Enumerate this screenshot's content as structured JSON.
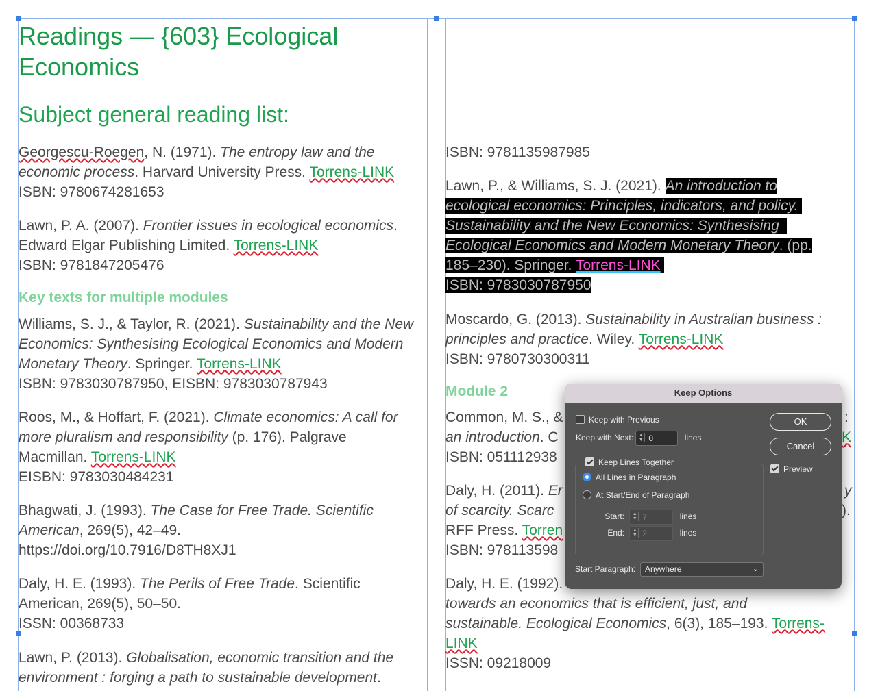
{
  "left": {
    "title": "Readings — {603} Ecological Economics",
    "subtitle": "Subject general reading list:",
    "entries": [
      {
        "pre": "Georgescu-Roegen",
        "pre2": ", N. (1971). ",
        "italic": "The entropy law and the economic process",
        "post": ". Harvard University Press. ",
        "link": "Torrens-LINK",
        "isbn": "ISBN: 9780674281653"
      },
      {
        "pre": "Lawn, P. A. (2007). ",
        "italic": "Frontier issues in ecological economics",
        "post": ". Edward Elgar Publishing Limited. ",
        "link": "Torrens-LINK",
        "isbn": "ISBN: 9781847205476"
      },
      {
        "pre": "Williams, S. J., & Taylor, R. (2021). ",
        "italic": "Sustainability and the New Economics: Synthesising Ecological Economics and Modern Monetary Theory",
        "post": ". Springer. ",
        "link": "Torrens-LINK",
        "isbn": "ISBN: 9783030787950, EISBN: 9783030787943"
      },
      {
        "pre": "Roos, M., & Hoffart, F. (2021). ",
        "italic": "Climate economics: A call for more pluralism and responsibility",
        "post": " (p. 176). Palgrave Macmillan. ",
        "link": "Torrens-LINK",
        "isbn": "EISBN: 9783030484231"
      },
      {
        "pre": "Bhagwati, J. (1993). ",
        "italic": "The Case for Free Trade. Scientific American",
        "post": ", 269(5), 42–49. ",
        "url": "https://doi.org/10.7916/D8TH8XJ1"
      },
      {
        "pre": "Daly, H. E. (1993). ",
        "italic": "The Perils of Free Trade",
        "post": ". Scientific American, 269(5), 50–50.",
        "isbn": "ISSN: 00368733"
      },
      {
        "pre": "Lawn, P. (2013). ",
        "italic": "Globalisation, economic transition and the environment : forging a path to sustainable development",
        "post": "."
      }
    ],
    "section_key_texts": "Key texts for multiple modules"
  },
  "right": {
    "top_isbn": "ISBN: 9781135987985",
    "selected": {
      "line1_plain": "Lawn, P., & Williams, S. J. (2021). ",
      "line1_italic": "An introduction to",
      "line2": "ecological economics: Principles, indicators, and policy.",
      "line3": "Sustainability and the New Economics: Synthesising",
      "line4_italic": "Ecological Economics and Modern Monetary Theory",
      "line4_post": ". (pp.",
      "line5": "185–230). Springer. ",
      "link": "Torrens-LINK",
      "isbn": "ISBN: 9783030787950"
    },
    "moscardo": {
      "pre": "Moscardo, G. (2013). ",
      "italic": "Sustainability in Australian business : principles and practice",
      "post": ". Wiley. ",
      "link": "Torrens-LINK",
      "isbn": "ISBN: 9780730300311"
    },
    "section_module2": "Module 2",
    "common": {
      "line1": "Common, M. S., &",
      "line1_tail": ":",
      "line2_italic": "an introduction",
      "line2_post": ". C",
      "line2_tail": "K",
      "isbn": "ISBN: 051112938"
    },
    "daly2011": {
      "line1": "Daly, H. (2011). ",
      "line1_italic": "Er",
      "line1_tail": "y",
      "line2_italic": "of scarcity. Scarc",
      "line2_tail": ").",
      "line3": "RFF Press. ",
      "line3_link": "Torren",
      "isbn": "ISBN: 978113598"
    },
    "daly1992": {
      "line1": "Daly, H. E. (1992).",
      "line2_italic": "towards an economics that is efficient, just, and",
      "line3_italic": "sustainable. Ecological Economics",
      "line3_post": ", 6(3), 185–193. ",
      "link": "Torrens-",
      "link2": "LINK",
      "isbn": "ISSN: 09218009"
    }
  },
  "dialog": {
    "title": "Keep Options",
    "keep_with_previous": "Keep with Previous",
    "keep_with_next": "Keep with Next:",
    "keep_with_next_value": "0",
    "lines": "lines",
    "keep_lines_together": "Keep Lines Together",
    "all_lines": "All Lines in Paragraph",
    "start_end": "At Start/End of Paragraph",
    "start_label": "Start:",
    "start_value": "7",
    "end_label": "End:",
    "end_value": "2",
    "start_paragraph_label": "Start Paragraph:",
    "start_paragraph_value": "Anywhere",
    "ok": "OK",
    "cancel": "Cancel",
    "preview": "Preview"
  }
}
